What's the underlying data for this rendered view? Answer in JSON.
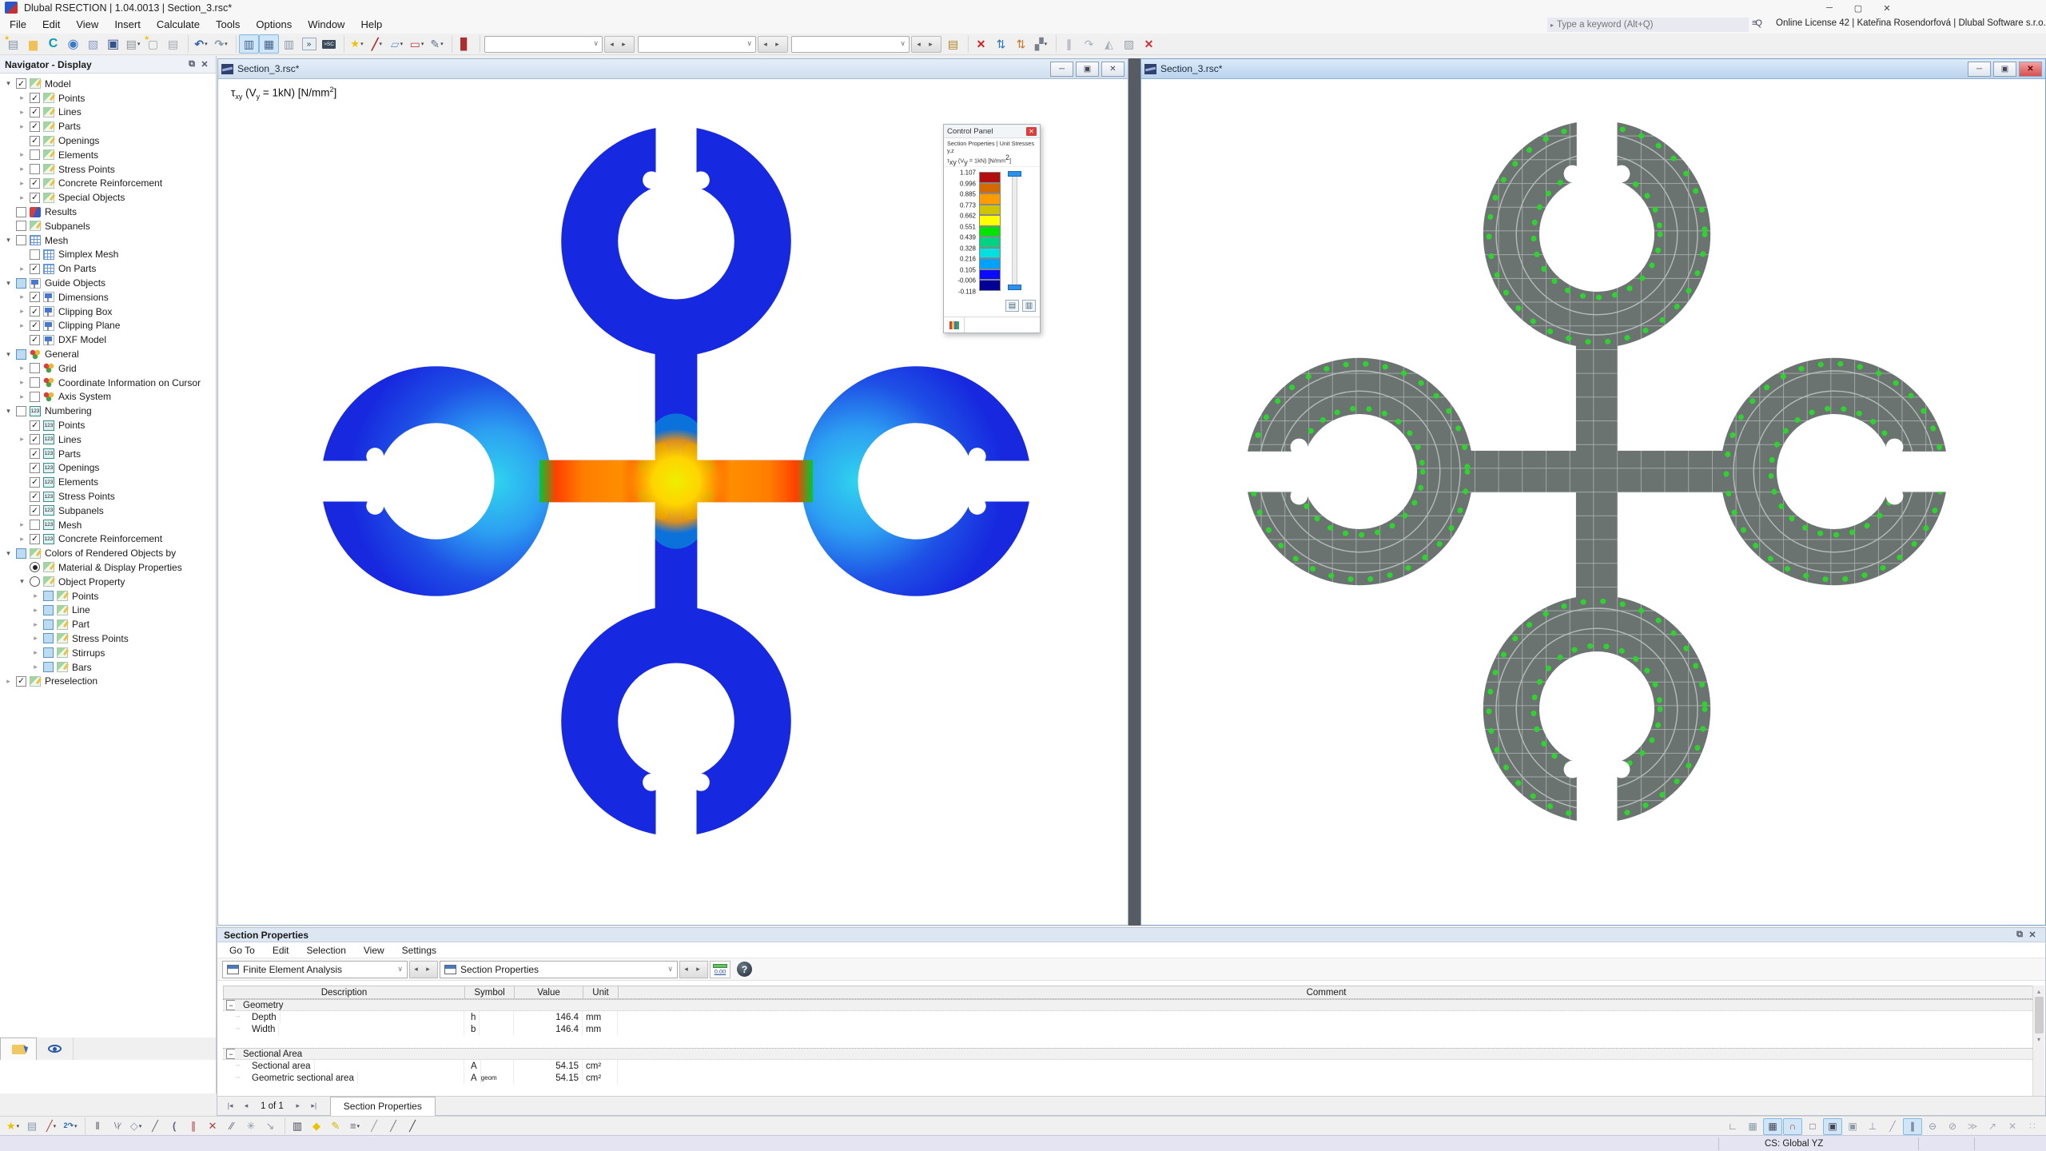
{
  "app": {
    "title": "Dlubal RSECTION | 1.04.0013 | Section_3.rsc*",
    "menus": [
      {
        "l": "File"
      },
      {
        "l": "Edit"
      },
      {
        "l": "View"
      },
      {
        "l": "Insert"
      },
      {
        "l": "Calculate"
      },
      {
        "l": "Tools"
      },
      {
        "l": "Options"
      },
      {
        "l": "Window"
      },
      {
        "l": "Help"
      }
    ],
    "search_placeholder": "Type a keyword (Alt+Q)",
    "license": "Online License 42 | Kateřina Rosendorfová | Dlubal Software s.r.o."
  },
  "toolbar": {
    "icons": [
      {
        "n": "new-model-icon",
        "k": "i-newdoc"
      },
      {
        "n": "open-file-icon",
        "k": "i-open"
      },
      {
        "n": "connect-icon",
        "k": "i-c"
      },
      {
        "n": "model-3d-icon",
        "k": "i-globe"
      },
      {
        "n": "import-icon",
        "k": "i-import"
      },
      {
        "n": "save-icon",
        "k": "i-save"
      },
      {
        "n": "print-icon",
        "k": "i-print",
        "dd": 1
      },
      {
        "n": "new-section-icon",
        "k": "i-newsec"
      },
      {
        "n": "section-list-icon",
        "k": "i-doc"
      },
      {
        "n": "separator",
        "k": "sep"
      },
      {
        "n": "undo-icon",
        "k": "i-undo",
        "dd": 1
      },
      {
        "n": "redo-icon",
        "k": "i-redo",
        "dd": 1
      },
      {
        "n": "separator",
        "k": "sep"
      },
      {
        "n": "navigator-toggle-icon",
        "k": "i-nav",
        "on": "on"
      },
      {
        "n": "tables-toggle-icon",
        "k": "i-tables",
        "on": "on"
      },
      {
        "n": "panel-toggle-icon",
        "k": "i-panel"
      },
      {
        "n": "console-icon",
        "k": "i-console"
      },
      {
        "n": "export-sc-icon",
        "k": "i-sc"
      },
      {
        "n": "separator",
        "k": "sep"
      },
      {
        "n": "new-node-icon",
        "k": "i-node",
        "dd": 1
      },
      {
        "n": "new-line-icon",
        "k": "i-line",
        "dd": 1
      },
      {
        "n": "new-part-icon",
        "k": "i-part",
        "dd": 1
      },
      {
        "n": "new-opening-icon",
        "k": "i-open2",
        "dd": 1
      },
      {
        "n": "new-element-icon",
        "k": "i-elem",
        "dd": 1
      },
      {
        "n": "separator",
        "k": "sep"
      },
      {
        "n": "material-library-icon",
        "k": "i-book"
      },
      {
        "n": "separator",
        "k": "sep"
      },
      {
        "n": "view-combo",
        "k": "combo"
      },
      {
        "n": "view-spin-buttons",
        "k": "pair"
      },
      {
        "n": "workplane-combo",
        "k": "combo"
      },
      {
        "n": "workplane-spin-buttons",
        "k": "pair"
      },
      {
        "n": "plane-combo",
        "k": "combo"
      },
      {
        "n": "plane-spin-buttons",
        "k": "pair"
      },
      {
        "n": "calculate-icon",
        "k": "i-calc"
      },
      {
        "n": "separator",
        "k": "sep"
      },
      {
        "n": "clear-results-icon",
        "k": "i-clearres"
      },
      {
        "n": "axes-y-icon",
        "k": "i-axy"
      },
      {
        "n": "axes-x-icon",
        "k": "i-axx"
      },
      {
        "n": "stress-analysis-icon",
        "k": "i-micro",
        "dd": 1
      },
      {
        "n": "separator",
        "k": "sep"
      },
      {
        "n": "measure-icon",
        "k": "i-meas"
      },
      {
        "n": "rotate-view-icon",
        "k": "i-rot"
      },
      {
        "n": "mirror-icon",
        "k": "i-mirror"
      },
      {
        "n": "clip-region-icon",
        "k": "i-clip"
      },
      {
        "n": "delete-icon",
        "k": "i-del"
      }
    ]
  },
  "navigator": {
    "title": "Navigator - Display",
    "tree": [
      {
        "l": "Model",
        "p": "d0",
        "c": "c",
        "e": "o",
        "i": "model"
      },
      {
        "l": "Points",
        "p": "d1",
        "c": "c",
        "e": "x",
        "i": "model"
      },
      {
        "l": "Lines",
        "p": "d1",
        "c": "c",
        "e": "x",
        "i": "model"
      },
      {
        "l": "Parts",
        "p": "d1",
        "c": "c",
        "e": "x",
        "i": "model"
      },
      {
        "l": "Openings",
        "p": "d1",
        "c": "c",
        "e": "n",
        "i": "model"
      },
      {
        "l": "Elements",
        "p": "d1",
        "c": "u",
        "e": "x",
        "i": "model"
      },
      {
        "l": "Stress Points",
        "p": "d1",
        "c": "u",
        "e": "x",
        "i": "model"
      },
      {
        "l": "Concrete Reinforcement",
        "p": "d1",
        "c": "c",
        "e": "x",
        "i": "model"
      },
      {
        "l": "Special Objects",
        "p": "d1",
        "c": "c",
        "e": "x",
        "i": "model"
      },
      {
        "l": "Results",
        "p": "d0",
        "c": "u",
        "e": "n",
        "i": "results"
      },
      {
        "l": "Subpanels",
        "p": "d0",
        "c": "u",
        "e": "n",
        "i": "model"
      },
      {
        "l": "Mesh",
        "p": "d0",
        "c": "u",
        "e": "o",
        "i": "mesh"
      },
      {
        "l": "Simplex Mesh",
        "p": "d1",
        "c": "u",
        "e": "n",
        "i": "mesh"
      },
      {
        "l": "On Parts",
        "p": "d1",
        "c": "c",
        "e": "x",
        "i": "mesh"
      },
      {
        "l": "Guide Objects",
        "p": "d0",
        "c": "p",
        "e": "o",
        "i": "guide"
      },
      {
        "l": "Dimensions",
        "p": "d1",
        "c": "c",
        "e": "x",
        "i": "guide"
      },
      {
        "l": "Clipping Box",
        "p": "d1",
        "c": "c",
        "e": "x",
        "i": "guide"
      },
      {
        "l": "Clipping Plane",
        "p": "d1",
        "c": "c",
        "e": "x",
        "i": "guide"
      },
      {
        "l": "DXF Model",
        "p": "d1",
        "c": "c",
        "e": "n",
        "i": "guide"
      },
      {
        "l": "General",
        "p": "d0",
        "c": "p",
        "e": "o",
        "i": "general"
      },
      {
        "l": "Grid",
        "p": "d1",
        "c": "u",
        "e": "x",
        "i": "general"
      },
      {
        "l": "Coordinate Information on Cursor",
        "p": "d1",
        "c": "u",
        "e": "x",
        "i": "general"
      },
      {
        "l": "Axis System",
        "p": "d1",
        "c": "u",
        "e": "x",
        "i": "general"
      },
      {
        "l": "Numbering",
        "p": "d0",
        "c": "u",
        "e": "o",
        "i": "num"
      },
      {
        "l": "Points",
        "p": "d1",
        "c": "c",
        "e": "n",
        "i": "num"
      },
      {
        "l": "Lines",
        "p": "d1",
        "c": "c",
        "e": "x",
        "i": "num"
      },
      {
        "l": "Parts",
        "p": "d1",
        "c": "c",
        "e": "n",
        "i": "num"
      },
      {
        "l": "Openings",
        "p": "d1",
        "c": "c",
        "e": "n",
        "i": "num"
      },
      {
        "l": "Elements",
        "p": "d1",
        "c": "c",
        "e": "n",
        "i": "num"
      },
      {
        "l": "Stress Points",
        "p": "d1",
        "c": "c",
        "e": "n",
        "i": "num"
      },
      {
        "l": "Subpanels",
        "p": "d1",
        "c": "c",
        "e": "n",
        "i": "num"
      },
      {
        "l": "Mesh",
        "p": "d1",
        "c": "u",
        "e": "x",
        "i": "num"
      },
      {
        "l": "Concrete Reinforcement",
        "p": "d1",
        "c": "c",
        "e": "x",
        "i": "num"
      },
      {
        "l": "Colors of Rendered Objects by",
        "p": "d0",
        "c": "p",
        "e": "o",
        "i": "model"
      },
      {
        "l": "Material & Display Properties",
        "p": "d1",
        "c": "r1",
        "e": "n",
        "i": "model"
      },
      {
        "l": "Object Property",
        "p": "d1",
        "c": "r0",
        "e": "o",
        "i": "model"
      },
      {
        "l": "Points",
        "p": "d2",
        "c": "p",
        "e": "x",
        "i": "model"
      },
      {
        "l": "Line",
        "p": "d2",
        "c": "p",
        "e": "x",
        "i": "model"
      },
      {
        "l": "Part",
        "p": "d2",
        "c": "p",
        "e": "x",
        "i": "model"
      },
      {
        "l": "Stress Points",
        "p": "d2",
        "c": "p",
        "e": "x",
        "i": "model"
      },
      {
        "l": "Stirrups",
        "p": "d2",
        "c": "p",
        "e": "x",
        "i": "model"
      },
      {
        "l": "Bars",
        "p": "d2",
        "c": "p",
        "e": "x",
        "i": "model"
      },
      {
        "l": "Preselection",
        "p": "d0",
        "c": "c",
        "e": "x",
        "i": "model"
      }
    ]
  },
  "stress_label": {
    "t1": "τ",
    "t2": "xy",
    "t3": " (V",
    "t4": "y",
    "t5": " = 1kN) [N/mm",
    "t6": "2",
    "t7": "]"
  },
  "viewport_left": {
    "tab_title": "Section_3.rsc*"
  },
  "viewport_right": {
    "tab_title": "Section_3.rsc*"
  },
  "control_panel": {
    "title": "Control Panel",
    "subtitle1": "Section Properties | Unit Stresses y,z",
    "scale_rows": [
      {
        "v": "1.107",
        "col": "#b40f0f"
      },
      {
        "v": "0.996",
        "col": "#d26a00"
      },
      {
        "v": "0.885",
        "col": "#ff9d00"
      },
      {
        "v": "0.773",
        "col": "#cfc400"
      },
      {
        "v": "0.662",
        "col": "#ffff00"
      },
      {
        "v": "0.551",
        "col": "#00e400"
      },
      {
        "v": "0.439",
        "col": "#00d284"
      },
      {
        "v": "0.328",
        "col": "#00e0e0"
      },
      {
        "v": "0.216",
        "col": "#00a2ff"
      },
      {
        "v": "0.105",
        "col": "#0a0aff"
      },
      {
        "v": "-0.006",
        "col": "#000096"
      }
    ],
    "last_label": "-0.118"
  },
  "chart_colors": {
    "stress_base_blue": "#1628e0",
    "stress_cyan": "#2fd4ee",
    "stress_red": "#ff3c00",
    "stress_orange": "#ff8e00",
    "stress_yellow": "#ffe000",
    "stress_green": "#00c832",
    "mesh_fill": "#6a736f",
    "mesh_line": "#b4bab7",
    "mesh_node_green": "#2fd32f"
  },
  "bottom_panel": {
    "title": "Section Properties",
    "menus": [
      {
        "l": "Go To"
      },
      {
        "l": "Edit"
      },
      {
        "l": "Selection"
      },
      {
        "l": "View"
      },
      {
        "l": "Settings"
      }
    ],
    "combo1": "Finite Element Analysis",
    "combo2": "Section Properties",
    "decimal_icon_label": "0,00",
    "table": {
      "headers": [
        {
          "h": "Description"
        },
        {
          "h": "Symbol"
        },
        {
          "h": "Value"
        },
        {
          "h": "Unit"
        },
        {
          "h": "Comment"
        }
      ],
      "rows": [
        {
          "t": "g",
          "isg": 1,
          "d": "Geometry"
        },
        {
          "t": "i",
          "d": "Depth",
          "s": "h",
          "s2": "",
          "v": "146.4",
          "u": "mm"
        },
        {
          "t": "i",
          "d": "Width",
          "s": "b",
          "s2": "",
          "v": "146.4",
          "u": "mm"
        },
        {
          "t": "s"
        },
        {
          "t": "g",
          "isg": 1,
          "d": "Sectional Area"
        },
        {
          "t": "i",
          "d": "Sectional area",
          "s": "A",
          "s2": "",
          "v": "54.15",
          "u": "cm²"
        },
        {
          "t": "i",
          "d": "Geometric sectional area",
          "s": "A",
          "s2": "geom",
          "v": "54.15",
          "u": "cm²"
        }
      ]
    },
    "pager": "1 of 1",
    "tab": "Section Properties"
  },
  "cad_toolbar": {
    "icons": [
      {
        "n": "new-dimension-icon",
        "k": "c-star",
        "dd": 1
      },
      {
        "n": "clipboard-icon",
        "k": "c-clip"
      },
      {
        "n": "measure-length-icon",
        "k": "c-measure",
        "dd": 1
      },
      {
        "n": "renumber-icon",
        "k": "c-renum",
        "dd": 1
      },
      {
        "n": "separator",
        "k": "sep"
      },
      {
        "n": "dim-vertical-icon",
        "k": "c-dimv"
      },
      {
        "n": "dim-fan-icon",
        "k": "c-fan"
      },
      {
        "n": "dim-diamond-icon",
        "k": "c-diam",
        "dd": 1
      },
      {
        "n": "dim-segment-icon",
        "k": "c-seg"
      },
      {
        "n": "dim-arc-icon",
        "k": "c-arc"
      },
      {
        "n": "dim-parallel-icon",
        "k": "c-par"
      },
      {
        "n": "dim-cross-icon",
        "k": "c-cross"
      },
      {
        "n": "dim-slope-icon",
        "k": "c-slope"
      },
      {
        "n": "dim-symbol-icon",
        "k": "c-sym"
      },
      {
        "n": "dim-node-icon",
        "k": "c-nodepick"
      },
      {
        "n": "separator",
        "k": "sep"
      },
      {
        "n": "section-lines-icon",
        "k": "c-bars"
      },
      {
        "n": "weld-icon",
        "k": "c-weld"
      },
      {
        "n": "weld-edit-icon",
        "k": "c-weld2"
      },
      {
        "n": "layers-icon",
        "k": "c-layers",
        "dd": 1
      },
      {
        "n": "rebar-icon",
        "k": "c-rebar1"
      },
      {
        "n": "rebar-bend-icon",
        "k": "c-rebar2"
      },
      {
        "n": "rebar-hook-icon",
        "k": "c-rebar3"
      }
    ]
  },
  "snap_toolbar": {
    "icons": [
      {
        "n": "origin-snap-icon",
        "k": "s-origin"
      },
      {
        "n": "grid-view-icon",
        "k": "s-grideye"
      },
      {
        "n": "grid-snap-icon",
        "k": "s-grid",
        "on": "on"
      },
      {
        "n": "object-snap-icon",
        "k": "s-magnet",
        "on": "on"
      },
      {
        "n": "endpoint-snap-icon",
        "k": "s-box"
      },
      {
        "n": "center-snap-icon",
        "k": "s-center",
        "on": "on"
      },
      {
        "n": "intersection-snap-icon",
        "k": "s-inter"
      },
      {
        "n": "perpendicular-snap-icon",
        "k": "s-perp"
      },
      {
        "n": "line-snap-icon",
        "k": "s-line"
      },
      {
        "n": "parallel-snap-icon",
        "k": "s-par",
        "on": "on"
      },
      {
        "n": "tangent-snap-icon",
        "k": "s-tan"
      },
      {
        "n": "circle-snap-icon",
        "k": "s-circ"
      },
      {
        "n": "guideline-snap-icon",
        "k": "s-g1"
      },
      {
        "n": "snap-arrow-icon",
        "k": "s-g2"
      },
      {
        "n": "snap-cross-icon",
        "k": "s-g3"
      },
      {
        "n": "snap-dots-icon",
        "k": "s-g4"
      }
    ]
  },
  "status_bar": {
    "cs": "CS: Global YZ"
  }
}
